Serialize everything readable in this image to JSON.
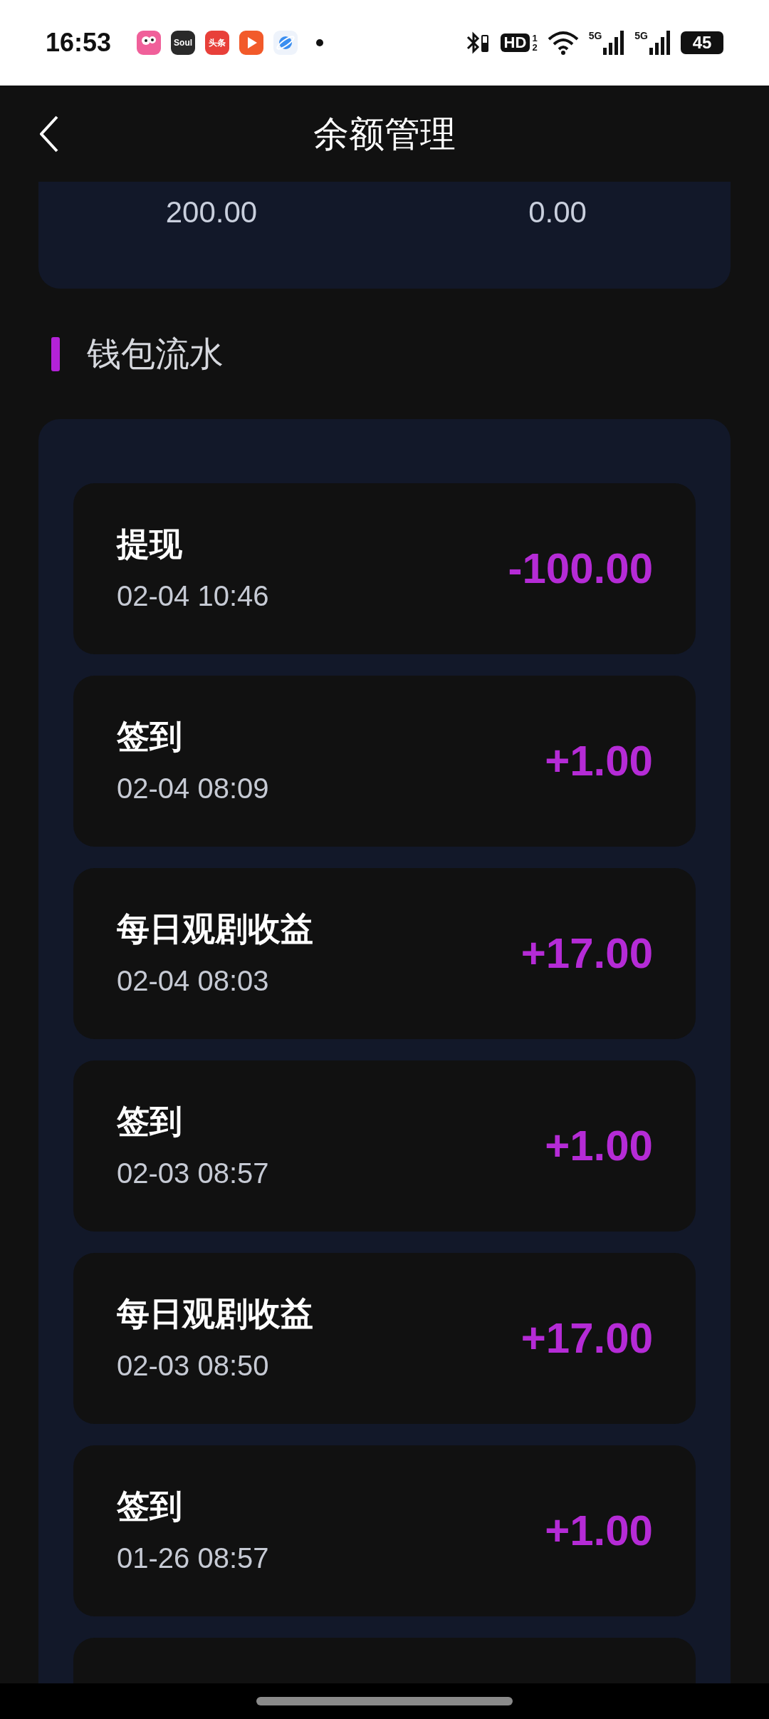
{
  "status_bar": {
    "time": "16:53",
    "apps": [
      {
        "kind": "face"
      },
      {
        "kind": "soul",
        "label": "Soul"
      },
      {
        "kind": "news",
        "label": "头条"
      },
      {
        "kind": "play"
      },
      {
        "kind": "planet"
      }
    ],
    "hd": "HD",
    "sims": [
      "1",
      "2"
    ],
    "networks": [
      "5G",
      "5G"
    ],
    "battery": "45"
  },
  "header": {
    "title": "余额管理"
  },
  "balance": {
    "values": [
      "200.00",
      "0.00"
    ]
  },
  "section": {
    "title": "钱包流水"
  },
  "transactions": [
    {
      "title": "提现",
      "date": "02-04 10:46",
      "amount": "-100.00"
    },
    {
      "title": "签到",
      "date": "02-04 08:09",
      "amount": "+1.00"
    },
    {
      "title": "每日观剧收益",
      "date": "02-04 08:03",
      "amount": "+17.00"
    },
    {
      "title": "签到",
      "date": "02-03 08:57",
      "amount": "+1.00"
    },
    {
      "title": "每日观剧收益",
      "date": "02-03 08:50",
      "amount": "+17.00"
    },
    {
      "title": "签到",
      "date": "01-26 08:57",
      "amount": "+1.00"
    }
  ]
}
